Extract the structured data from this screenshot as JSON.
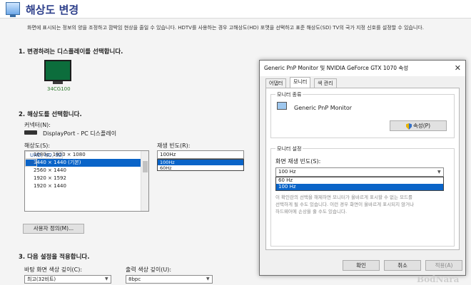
{
  "header": {
    "title": "해상도 변경"
  },
  "description": "화면에 표시되는 정보의 양을 조정하고 깜박임 현상을 줄일 수 있습니다. HDTV를 사용하는 경우 고해상도(HD) 포맷을 선택하고 표준 해상도(SD) TV의 국가 지정 신호를 설정할 수 있습니다.",
  "step1": {
    "heading": "1. 변경하려는 디스플레이를 선택합니다.",
    "display_label": "34CG100"
  },
  "step2": {
    "heading": "2. 해상도를 선택합니다.",
    "connector_label": "커넥터(N):",
    "connector_value": "DisplayPort - PC 디스플레이",
    "resolution_label": "해상도(S):",
    "resolution_list": [
      {
        "text": "UHD, HD, SD",
        "type": "group"
      },
      {
        "text": "1080p, 1920 × 1080",
        "type": "item"
      },
      {
        "text": "PC",
        "type": "group"
      },
      {
        "text": "3440 × 1440 (기본)",
        "type": "selected"
      },
      {
        "text": "2560 × 1440",
        "type": "item"
      },
      {
        "text": "1920 × 1592",
        "type": "item"
      },
      {
        "text": "1920 × 1440",
        "type": "item"
      }
    ],
    "refresh_label": "재생 빈도(R):",
    "refresh_value": "100Hz",
    "refresh_options": [
      "100Hz",
      "60Hz"
    ],
    "custom_button": "사용자 정의(M)..."
  },
  "step3": {
    "heading": "3. 다음 설정을 적용합니다.",
    "desktop_color_label": "바탕 화면 색상 깊이(C):",
    "desktop_color_value": "최고(32비트)",
    "output_color_label": "출력 색상 깊이(U):",
    "output_color_value": "8bpc"
  },
  "dialog": {
    "title": "Generic PnP Monitor 및 NVIDIA GeForce GTX 1070 속성",
    "close": "✕",
    "tabs": [
      "어댑터",
      "모니터",
      "색 관리"
    ],
    "monitor_type_group": "모니터 종류",
    "monitor_name": "Generic PnP Monitor",
    "properties_button": "속성(P)",
    "monitor_settings_group": "모니터 설정",
    "refresh_label": "화면 재생 빈도(S):",
    "refresh_value": "100 Hz",
    "refresh_options": [
      "60 Hz",
      "100 Hz"
    ],
    "info_lines": [
      "이 확인란의 선택을 해제하면 모니터가 올바르게 표시할 수 없는 모드를",
      "선택하게 될 수도 있습니다. 이런 경우 화면이 올바르게 표시되지 않거나",
      "하드웨어에 손상을 줄 수도 있습니다."
    ],
    "ok_button": "확인",
    "cancel_button": "취소",
    "apply_button": "적용(A)"
  },
  "watermark": "BodNara"
}
